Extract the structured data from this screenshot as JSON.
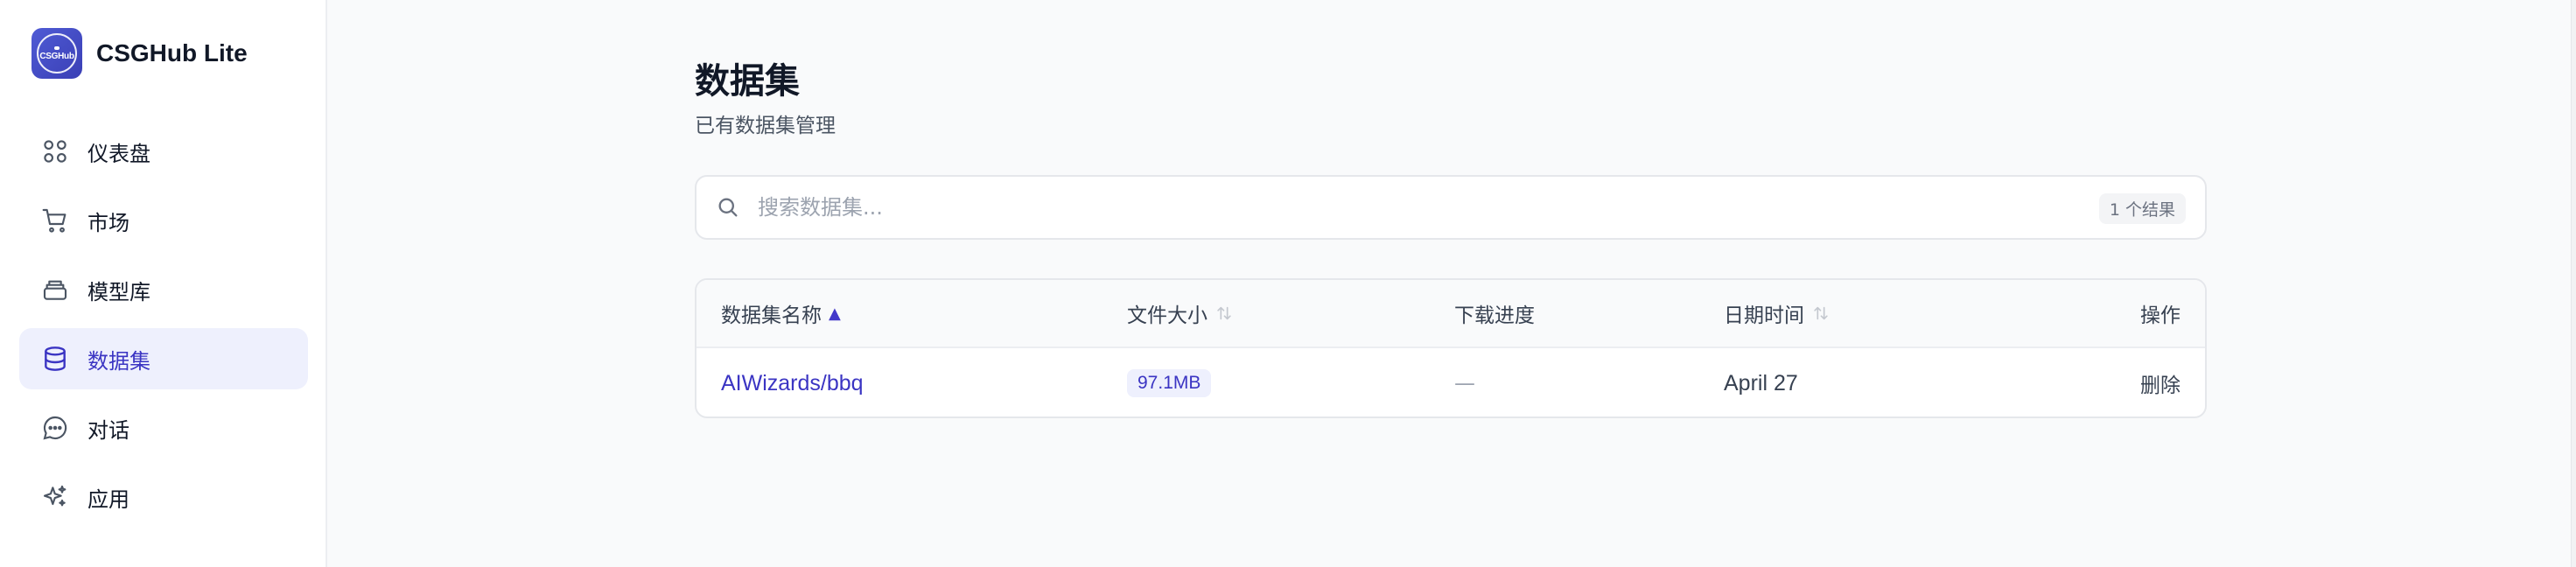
{
  "app": {
    "name": "CSGHub Lite",
    "logo_text": "CSGHub"
  },
  "sidebar": {
    "items": [
      {
        "label": "仪表盘",
        "icon": "dashboard-icon"
      },
      {
        "label": "市场",
        "icon": "cart-icon"
      },
      {
        "label": "模型库",
        "icon": "model-library-icon"
      },
      {
        "label": "数据集",
        "icon": "database-icon",
        "active": true
      },
      {
        "label": "对话",
        "icon": "chat-icon"
      },
      {
        "label": "应用",
        "icon": "sparkles-icon"
      }
    ]
  },
  "page": {
    "title": "数据集",
    "subtitle": "已有数据集管理"
  },
  "search": {
    "placeholder": "搜索数据集...",
    "value": "",
    "result_count": "1 个结果"
  },
  "table": {
    "columns": [
      "数据集名称",
      "文件大小",
      "下载进度",
      "日期时间",
      "操作"
    ],
    "sort_asc_glyph": "▲",
    "rows": [
      {
        "name": "AIWizards/bbq",
        "size": "97.1MB",
        "progress": "—",
        "date": "April 27",
        "action": "删除"
      }
    ]
  },
  "colors": {
    "accent": "#3b35c3",
    "active_bg": "#eef0fd",
    "border": "#e5e7eb"
  }
}
